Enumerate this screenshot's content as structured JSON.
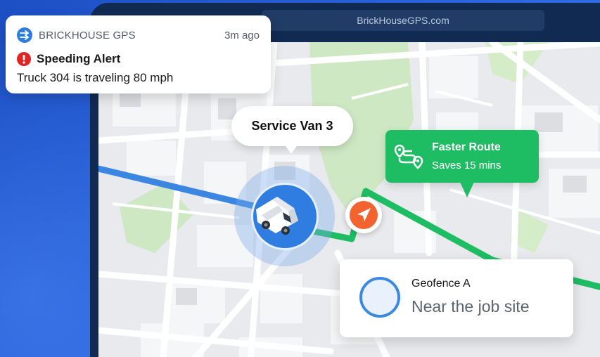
{
  "browser": {
    "address": "BrickHouseGPS.com"
  },
  "notification": {
    "app_name": "BRICKHOUSE GPS",
    "time": "3m ago",
    "title": "Speeding Alert",
    "body": "Truck 304 is traveling 80 mph",
    "alert_color": "#e02424"
  },
  "map": {
    "vehicle_label": "Service Van 3",
    "route_card": {
      "title": "Faster Route",
      "subtitle": "Saves 15 mins"
    },
    "geofence": {
      "label": "Geofence A",
      "status": "Near the job site"
    }
  },
  "colors": {
    "brand_blue": "#2f7de0",
    "route_green": "#1fbd63",
    "current_route_blue": "#3a86e0",
    "nav_orange": "#f2632f"
  }
}
